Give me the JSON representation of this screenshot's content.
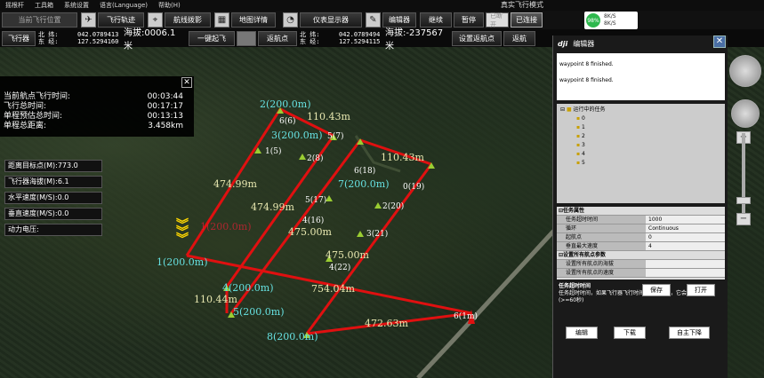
{
  "menu": [
    "摇根杆",
    "工具箱",
    "系统设置",
    "语言(Language)",
    "帮助(H)"
  ],
  "mode_title": "真实飞行模式",
  "toolbar1": {
    "location_label": "当前飞行位置",
    "flight_path": "飞行轨迹",
    "aerial": "航线拨影",
    "map_detail": "地图详情",
    "instruments": "仪表显示器",
    "editor": "编辑器",
    "continue": "继续",
    "pause": "暂停",
    "disconnected": "已断开",
    "connected": "已连接"
  },
  "battery": {
    "pct": "98%",
    "line1": "8K/S",
    "line2": "8K/S"
  },
  "toolbar2": {
    "aircraft": "飞行器",
    "north_label": "北  纬:",
    "east_label": "东  经:",
    "lat1": "042.0789413",
    "lon1": "127.5294160",
    "alt1": "海拔:0006.1 米",
    "takeoff": "一键起飞",
    "return_point": "返航点",
    "lat2": "042.0789494",
    "lon2": "127.5294115",
    "alt2": "海拔:-237567米",
    "set_return": "设置返航点",
    "return": "返航"
  },
  "infopanel": {
    "rows": [
      {
        "k": "当前航点飞行时间:",
        "v": "00:03:44"
      },
      {
        "k": "飞行总时间:",
        "v": "00:17:17"
      },
      {
        "k": "单程预估总时间:",
        "v": "00:13:13"
      },
      {
        "k": "单程总距离:",
        "v": "3.458km"
      }
    ]
  },
  "datapanel": [
    "距离目标点(M):773.0",
    "飞行器海拔(M):6.1",
    "水平速度(M/S):0.0",
    "垂直速度(M/S):0.0",
    "动力电压:"
  ],
  "editor": {
    "title": "编辑器",
    "log": [
      "waypoint 8 finished.",
      "waypoint 8 finished."
    ],
    "tree_root": "运行中的任务",
    "tree_nodes": [
      "0",
      "1",
      "2",
      "3",
      "4",
      "5"
    ],
    "props_title": "任务属性",
    "props": [
      {
        "k": "任务超时时间",
        "v": "1000"
      },
      {
        "k": "循环",
        "v": "Continuous"
      },
      {
        "k": "起航点",
        "v": "0"
      },
      {
        "k": "垂直最大速度",
        "v": "4"
      }
    ],
    "props2_title": "设置所有航点参数",
    "props2": [
      "设置所有航点的海拔",
      "设置所有航点的速度"
    ],
    "desc_title": "任务超时时间",
    "desc_text": "任务超时时间，如果飞行器飞行时间超过这个值，它会自动返航。(>=60秒)",
    "save": "保存",
    "open": "打开",
    "edit": "编辑",
    "upload": "下载",
    "autoland": "自主下降"
  },
  "map": {
    "distances": [
      "110.43m",
      "110.43m",
      "474.99m",
      "474.99m",
      "475.00m",
      "475.00m",
      "110.44m",
      "754.04m",
      "472.63m"
    ],
    "waypoints": [
      "2(200.0m)",
      "6(6)",
      "3(200.0m)",
      "5(7)",
      "1(5)",
      "2(8)",
      "6(18)",
      "7(200.0m)",
      "0(19)",
      "5(17)",
      "2(20)",
      "4(16)",
      "3(21)",
      "4(22)",
      "1(200.0m)",
      "4(200.0m)",
      "5(200.0m)",
      "8(200.0m)",
      "6(1m)",
      "1(200.0m)"
    ]
  }
}
